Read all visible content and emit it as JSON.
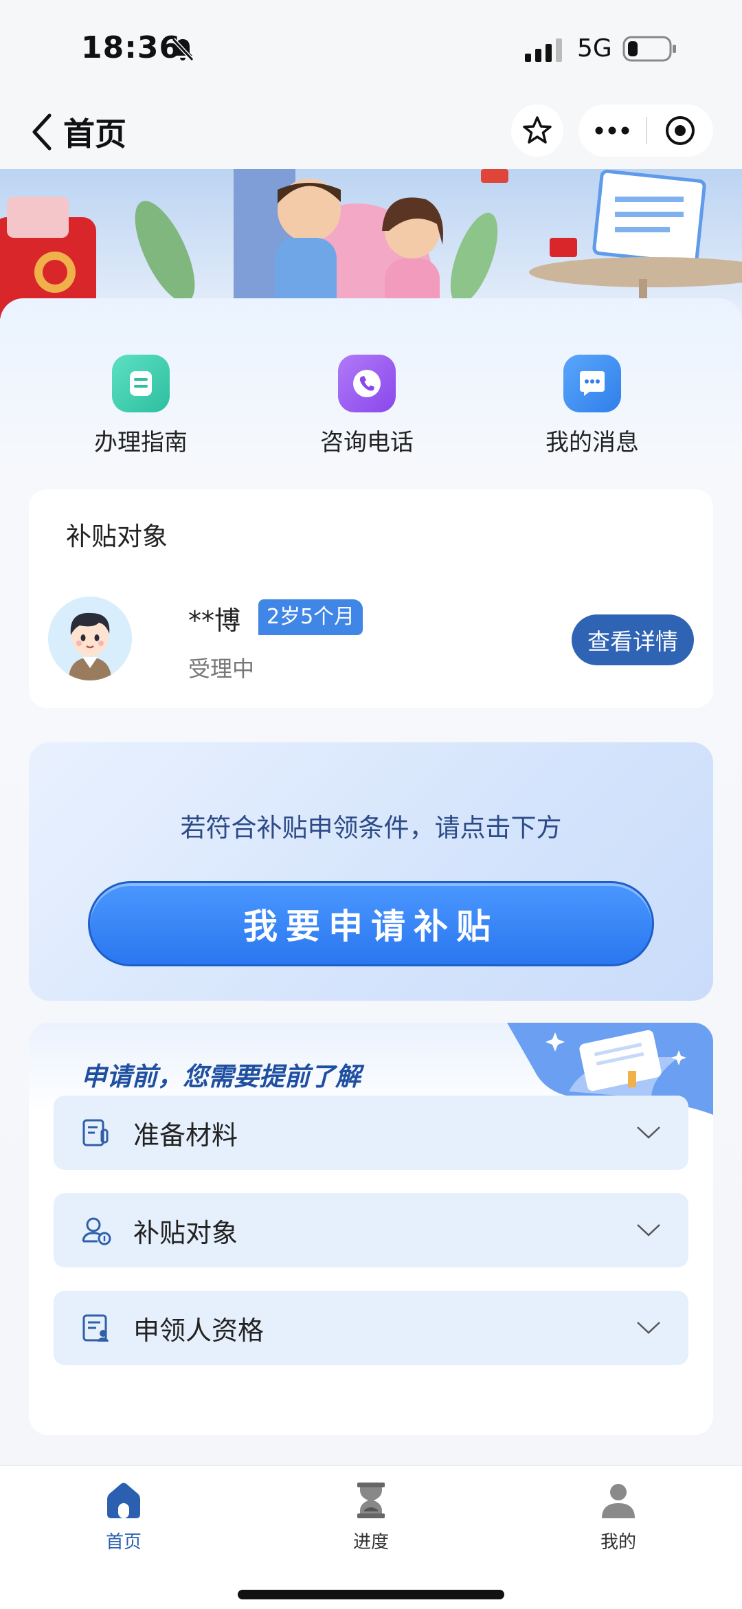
{
  "status_bar": {
    "time": "18:36",
    "network": "5G"
  },
  "nav": {
    "title": "首页",
    "icons": [
      "back-arrow-icon",
      "star-icon",
      "more-icon",
      "close-circle-icon"
    ]
  },
  "quick_entries": [
    {
      "label": "办理指南",
      "icon": "guide-icon",
      "color": "#3ecfb0"
    },
    {
      "label": "咨询电话",
      "icon": "phone-icon",
      "color": "#9a59f0"
    },
    {
      "label": "我的消息",
      "icon": "message-icon",
      "color": "#3a8ff2"
    }
  ],
  "subsidy_card": {
    "title": "补贴对象",
    "child_name": "**博",
    "age": "2岁5个月",
    "status": "受理中",
    "detail_button": "查看详情"
  },
  "apply": {
    "hint": "若符合补贴申领条件，请点击下方",
    "button": "我要申请补贴"
  },
  "info": {
    "title": "申请前，您需要提前了解",
    "items": [
      {
        "label": "准备材料",
        "icon": "document-icon"
      },
      {
        "label": "补贴对象",
        "icon": "person-coin-icon"
      },
      {
        "label": "申领人资格",
        "icon": "id-form-icon"
      }
    ]
  },
  "tabbar": {
    "tabs": [
      {
        "label": "首页",
        "icon": "home-icon",
        "active": true
      },
      {
        "label": "进度",
        "icon": "hourglass-icon",
        "active": false
      },
      {
        "label": "我的",
        "icon": "user-icon",
        "active": false
      }
    ],
    "active_color": "#2b5fb0",
    "inactive_color": "#333333"
  }
}
